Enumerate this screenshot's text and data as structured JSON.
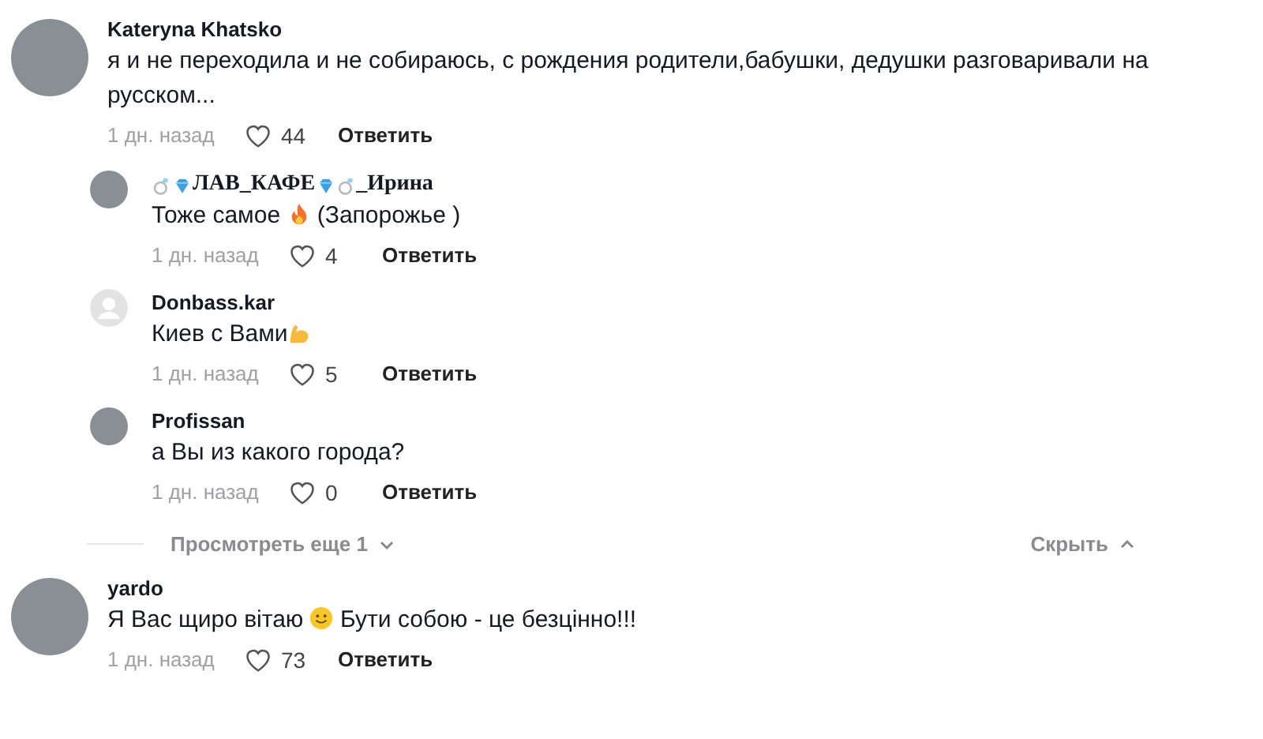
{
  "comments": [
    {
      "avatar": {
        "kind": "photo"
      },
      "author": [
        {
          "kind": "text",
          "text": "Kateryna Khatsko"
        }
      ],
      "body": [
        {
          "kind": "text",
          "text": "я и не переходила и не собираюсь, с рождения родители,бабушки, дедушки разговаривали на русском..."
        }
      ],
      "time": "1 дн. назад",
      "likes": "44",
      "reply_label": "Ответить",
      "replies": [
        {
          "avatar": {
            "kind": "photo"
          },
          "author": [
            {
              "kind": "ring"
            },
            {
              "kind": "diamond"
            },
            {
              "kind": "serif",
              "text": "ЛАВ_КАФЕ"
            },
            {
              "kind": "diamond"
            },
            {
              "kind": "ring"
            },
            {
              "kind": "serif",
              "text": "_Ирина"
            }
          ],
          "body": [
            {
              "kind": "text",
              "text": "Тоже самое "
            },
            {
              "kind": "fire"
            },
            {
              "kind": "text",
              "text": " (Запорожье )"
            }
          ],
          "time": "1 дн. назад",
          "likes": "4",
          "reply_label": "Ответить"
        },
        {
          "avatar": {
            "kind": "default"
          },
          "author": [
            {
              "kind": "text",
              "text": "Donbass.kar"
            }
          ],
          "body": [
            {
              "kind": "text",
              "text": "Киев с Вами"
            },
            {
              "kind": "muscle"
            }
          ],
          "time": "1 дн. назад",
          "likes": "5",
          "reply_label": "Ответить"
        },
        {
          "avatar": {
            "kind": "photo"
          },
          "author": [
            {
              "kind": "text",
              "text": "Profissan"
            }
          ],
          "body": [
            {
              "kind": "text",
              "text": "а Вы из какого города?"
            }
          ],
          "time": "1 дн. назад",
          "likes": "0",
          "reply_label": "Ответить"
        }
      ],
      "more_label": "Просмотреть еще 1",
      "hide_label": "Скрыть"
    },
    {
      "avatar": {
        "kind": "photo"
      },
      "author": [
        {
          "kind": "text",
          "text": "yardo"
        }
      ],
      "body": [
        {
          "kind": "text",
          "text": "Я Вас щиро вітаю "
        },
        {
          "kind": "smile"
        },
        {
          "kind": "text",
          "text": " Бути собою - це безцінно!!!"
        }
      ],
      "time": "1 дн. назад",
      "likes": "73",
      "reply_label": "Ответить"
    }
  ]
}
